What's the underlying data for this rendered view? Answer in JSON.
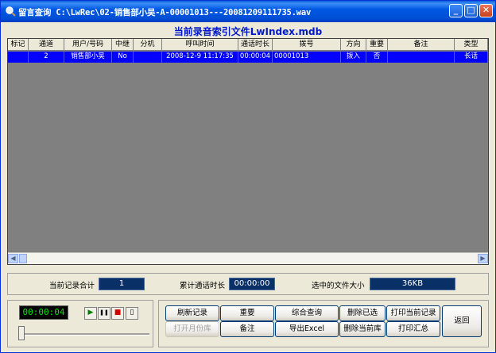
{
  "window": {
    "title": "留言查询  C:\\LwRec\\02-销售部小吴-A-00001013---20081209111735.wav",
    "controls": [
      "_",
      "□",
      "✕"
    ]
  },
  "panel_title": "当前录音索引文件LwIndex.mdb",
  "table": {
    "columns": [
      "标记",
      "通道",
      "用户/号码",
      "中继",
      "分机",
      "呼叫时间",
      "通话时长",
      "拨号",
      "方向",
      "重要",
      "备注",
      "类型"
    ],
    "rows": [
      [
        "",
        "2",
        "销售部小吴",
        "No",
        "",
        "2008-12-9 11:17:35",
        "00:00:04",
        "00001013",
        "拨入",
        "否",
        "",
        "长话"
      ]
    ]
  },
  "stats": {
    "record_count_label": "当前记录合计",
    "record_count": "1",
    "total_duration_label": "累计通话时长",
    "total_duration": "00:00:00",
    "selected_size_label": "选中的文件大小",
    "selected_size": "36KB"
  },
  "player": {
    "time": "00:00:04",
    "play_glyph": "▶",
    "pause_glyph": "❚❚",
    "stop_glyph": "■",
    "open_glyph": "▯"
  },
  "actions": {
    "refresh": "刷新记录",
    "important": "重要",
    "search": "综合查询",
    "delete_selected": "删除已选",
    "print_current": "打印当前记录",
    "back": "返回",
    "open_month": "打开月份库",
    "note": "备注",
    "export_excel": "导出Excel",
    "delete_current_db": "删除当前库",
    "print_summary": "打印汇总"
  },
  "colors": {
    "title_blue": "#0019c8",
    "selected_row": "#0000ff",
    "grid_bg": "#808080",
    "stat_box": "#0a3068"
  }
}
